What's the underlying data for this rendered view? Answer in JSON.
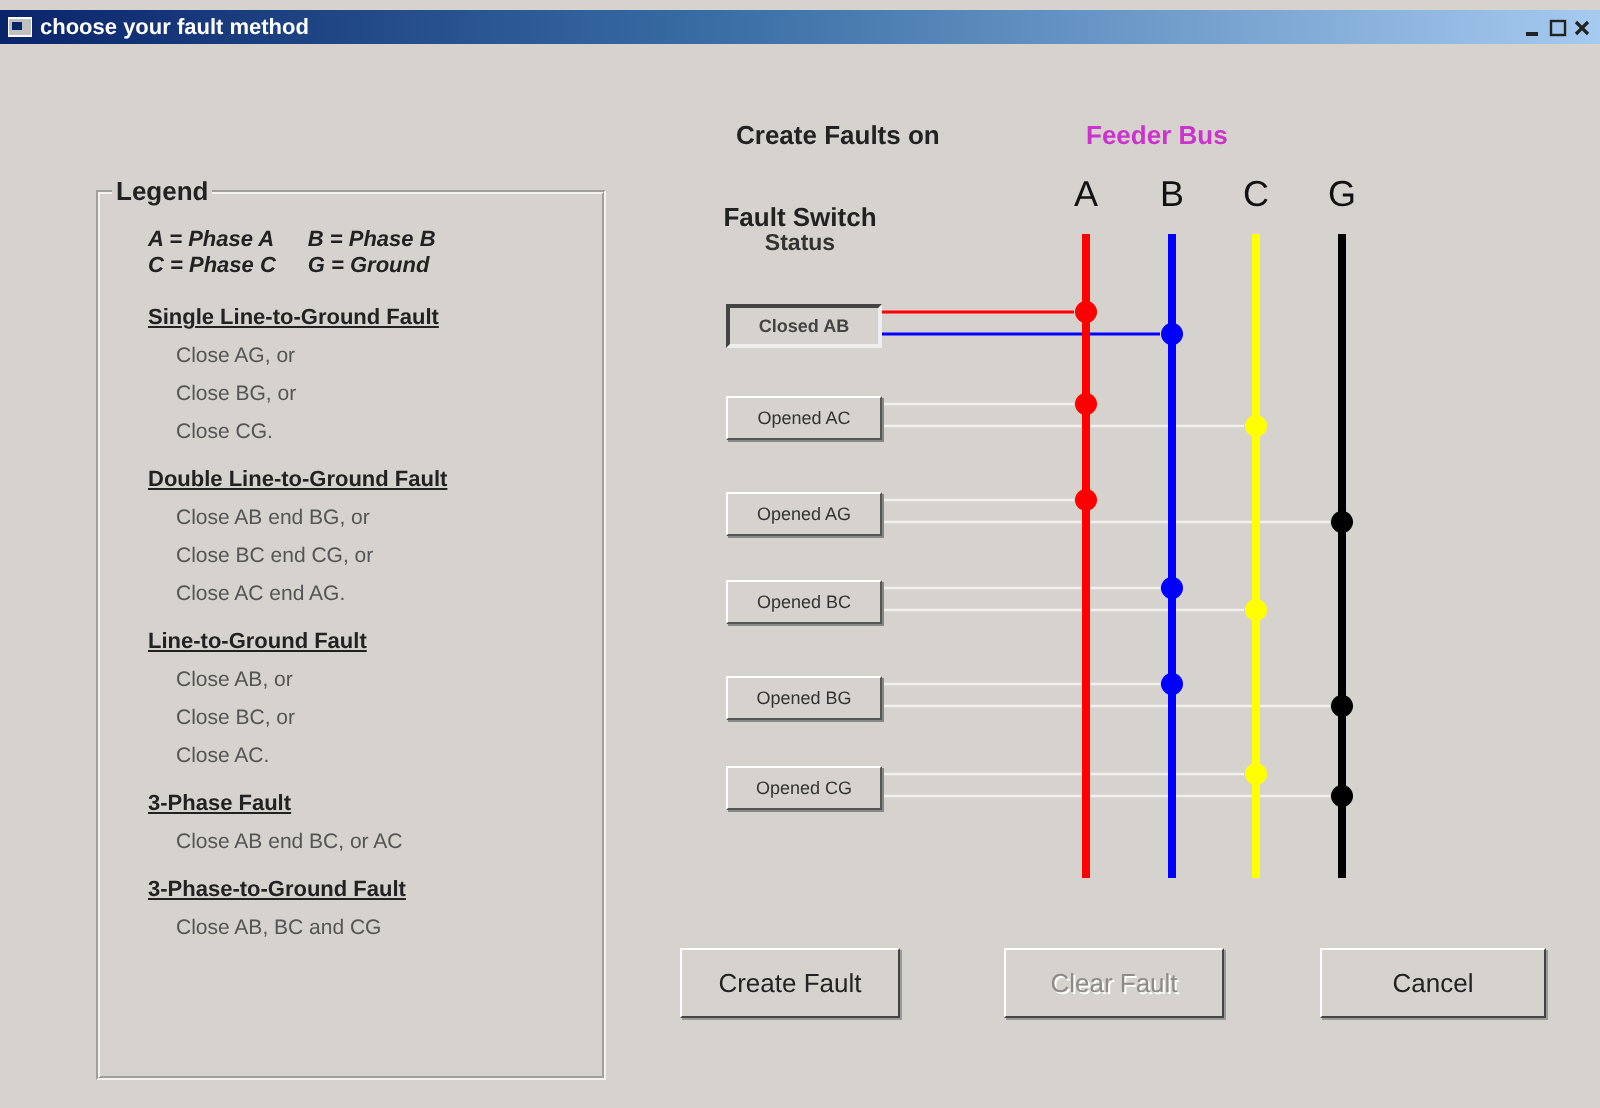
{
  "window": {
    "title": "choose your fault method"
  },
  "legend": {
    "title": "Legend",
    "key": [
      "A = Phase A",
      "B = Phase B",
      "C = Phase C",
      "G = Ground"
    ],
    "sections": [
      {
        "heading": "Single Line-to-Ground Fault",
        "lines": [
          "Close AG, or",
          "Close BG, or",
          "Close CG."
        ]
      },
      {
        "heading": "Double Line-to-Ground Fault",
        "lines": [
          "Close AB end BG, or",
          "Close BC end CG, or",
          "Close AC end AG."
        ]
      },
      {
        "heading": "Line-to-Ground Fault",
        "lines": [
          "Close AB, or",
          "Close BC, or",
          "Close AC."
        ]
      },
      {
        "heading": "3-Phase Fault",
        "lines": [
          "Close AB end BC, or AC"
        ]
      },
      {
        "heading": "3-Phase-to-Ground Fault",
        "lines": [
          "Close AB, BC and CG"
        ]
      }
    ]
  },
  "header": {
    "label": "Create Faults on",
    "target": "Feeder Bus"
  },
  "diagram": {
    "status_title": "Fault Switch",
    "status_subtitle": "Status",
    "buses": [
      {
        "label": "A",
        "color": "#ff0000"
      },
      {
        "label": "B",
        "color": "#0000ff"
      },
      {
        "label": "C",
        "color": "#ffff00"
      },
      {
        "label": "G",
        "color": "#000000"
      }
    ],
    "switches": [
      {
        "label": "Closed AB",
        "closed": true,
        "contacts": [
          true,
          true,
          false,
          false
        ]
      },
      {
        "label": "Opened AC",
        "closed": false,
        "contacts": [
          true,
          false,
          true,
          false
        ]
      },
      {
        "label": "Opened AG",
        "closed": false,
        "contacts": [
          true,
          false,
          false,
          true
        ]
      },
      {
        "label": "Opened BC",
        "closed": false,
        "contacts": [
          false,
          true,
          true,
          false
        ]
      },
      {
        "label": "Opened BG",
        "closed": false,
        "contacts": [
          false,
          true,
          false,
          true
        ]
      },
      {
        "label": "Opened CG",
        "closed": false,
        "contacts": [
          false,
          false,
          true,
          true
        ]
      }
    ]
  },
  "buttons": [
    {
      "label": "Create Fault",
      "disabled": false
    },
    {
      "label": "Clear Fault",
      "disabled": true
    },
    {
      "label": "Cancel",
      "disabled": false
    }
  ]
}
